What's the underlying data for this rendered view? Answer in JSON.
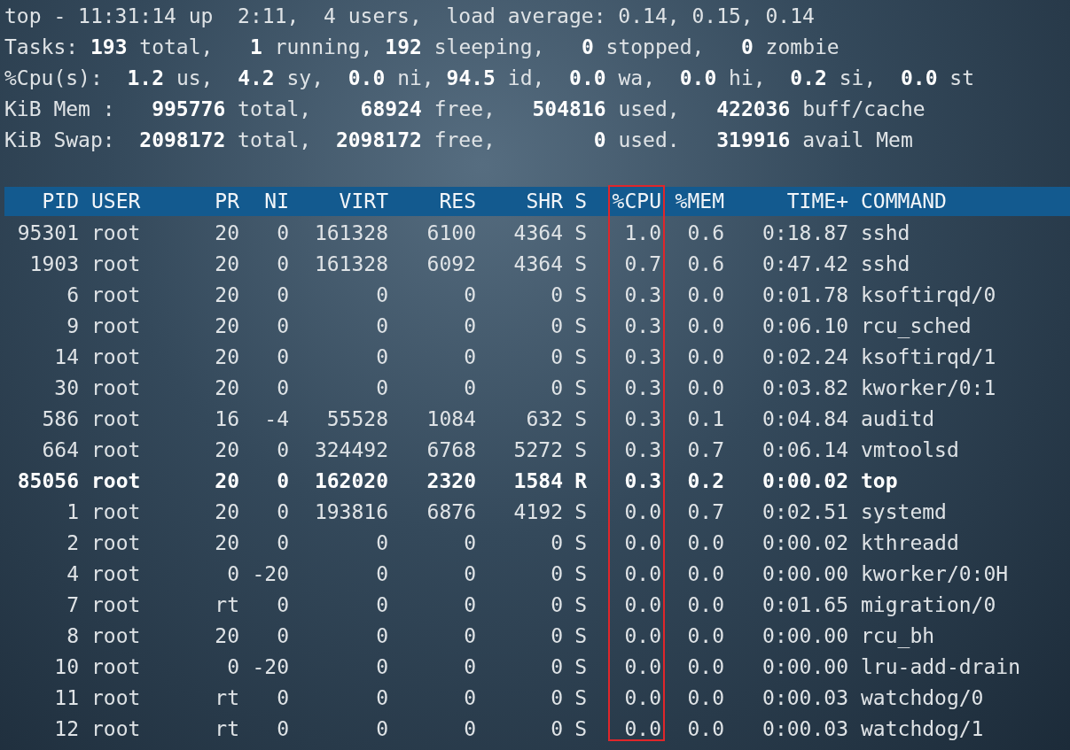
{
  "summary": [
    "top - 11:31:14 up  2:11,  4 users,  load average: 0.14, 0.15, 0.14",
    "Tasks: **193** total,   **1** running, **192** sleeping,   **0** stopped,   **0** zombie",
    "%Cpu(s):  **1.2** us,  **4.2** sy,  **0.0** ni, **94.5** id,  **0.0** wa,  **0.0** hi,  **0.2** si,  **0.0** st",
    "KiB Mem :   **995776** total,    **68924** free,   **504816** used,   **422036** buff/cache",
    "KiB Swap:  **2098172** total,  **2098172** free,        **0** used.   **319916** avail Mem"
  ],
  "table": {
    "columns": [
      {
        "label": "PID",
        "highlighted": false
      },
      {
        "label": "USER",
        "highlighted": false
      },
      {
        "label": "PR",
        "highlighted": false
      },
      {
        "label": "NI",
        "highlighted": false
      },
      {
        "label": "VIRT",
        "highlighted": false
      },
      {
        "label": "RES",
        "highlighted": false
      },
      {
        "label": "SHR",
        "highlighted": false
      },
      {
        "label": "S",
        "highlighted": false
      },
      {
        "label": "%CPU",
        "highlighted": true
      },
      {
        "label": "%MEM",
        "highlighted": false
      },
      {
        "label": "TIME+",
        "highlighted": false
      },
      {
        "label": "COMMAND",
        "highlighted": false
      }
    ],
    "rows": [
      {
        "highlighted": false,
        "cells": [
          "95301",
          "root",
          "20",
          "0",
          "161328",
          "6100",
          "4364",
          "S",
          "1.0",
          "0.6",
          "0:18.87",
          "sshd"
        ]
      },
      {
        "highlighted": false,
        "cells": [
          "1903",
          "root",
          "20",
          "0",
          "161328",
          "6092",
          "4364",
          "S",
          "0.7",
          "0.6",
          "0:47.42",
          "sshd"
        ]
      },
      {
        "highlighted": false,
        "cells": [
          "6",
          "root",
          "20",
          "0",
          "0",
          "0",
          "0",
          "S",
          "0.3",
          "0.0",
          "0:01.78",
          "ksoftirqd/0"
        ]
      },
      {
        "highlighted": false,
        "cells": [
          "9",
          "root",
          "20",
          "0",
          "0",
          "0",
          "0",
          "S",
          "0.3",
          "0.0",
          "0:06.10",
          "rcu_sched"
        ]
      },
      {
        "highlighted": false,
        "cells": [
          "14",
          "root",
          "20",
          "0",
          "0",
          "0",
          "0",
          "S",
          "0.3",
          "0.0",
          "0:02.24",
          "ksoftirqd/1"
        ]
      },
      {
        "highlighted": false,
        "cells": [
          "30",
          "root",
          "20",
          "0",
          "0",
          "0",
          "0",
          "S",
          "0.3",
          "0.0",
          "0:03.82",
          "kworker/0:1"
        ]
      },
      {
        "highlighted": false,
        "cells": [
          "586",
          "root",
          "16",
          "-4",
          "55528",
          "1084",
          "632",
          "S",
          "0.3",
          "0.1",
          "0:04.84",
          "auditd"
        ]
      },
      {
        "highlighted": false,
        "cells": [
          "664",
          "root",
          "20",
          "0",
          "324492",
          "6768",
          "5272",
          "S",
          "0.3",
          "0.7",
          "0:06.14",
          "vmtoolsd"
        ]
      },
      {
        "highlighted": true,
        "cells": [
          "85056",
          "root",
          "20",
          "0",
          "162020",
          "2320",
          "1584",
          "R",
          "0.3",
          "0.2",
          "0:00.02",
          "top"
        ]
      },
      {
        "highlighted": false,
        "cells": [
          "1",
          "root",
          "20",
          "0",
          "193816",
          "6876",
          "4192",
          "S",
          "0.0",
          "0.7",
          "0:02.51",
          "systemd"
        ]
      },
      {
        "highlighted": false,
        "cells": [
          "2",
          "root",
          "20",
          "0",
          "0",
          "0",
          "0",
          "S",
          "0.0",
          "0.0",
          "0:00.02",
          "kthreadd"
        ]
      },
      {
        "highlighted": false,
        "cells": [
          "4",
          "root",
          "0",
          "-20",
          "0",
          "0",
          "0",
          "S",
          "0.0",
          "0.0",
          "0:00.00",
          "kworker/0:0H"
        ]
      },
      {
        "highlighted": false,
        "cells": [
          "7",
          "root",
          "rt",
          "0",
          "0",
          "0",
          "0",
          "S",
          "0.0",
          "0.0",
          "0:01.65",
          "migration/0"
        ]
      },
      {
        "highlighted": false,
        "cells": [
          "8",
          "root",
          "20",
          "0",
          "0",
          "0",
          "0",
          "S",
          "0.0",
          "0.0",
          "0:00.00",
          "rcu_bh"
        ]
      },
      {
        "highlighted": false,
        "cells": [
          "10",
          "root",
          "0",
          "-20",
          "0",
          "0",
          "0",
          "S",
          "0.0",
          "0.0",
          "0:00.00",
          "lru-add-drain"
        ]
      },
      {
        "highlighted": false,
        "cells": [
          "11",
          "root",
          "rt",
          "0",
          "0",
          "0",
          "0",
          "S",
          "0.0",
          "0.0",
          "0:00.03",
          "watchdog/0"
        ]
      },
      {
        "highlighted": false,
        "cells": [
          "12",
          "root",
          "rt",
          "0",
          "0",
          "0",
          "0",
          "S",
          "0.0",
          "0.0",
          "0:00.03",
          "watchdog/1"
        ]
      }
    ]
  }
}
